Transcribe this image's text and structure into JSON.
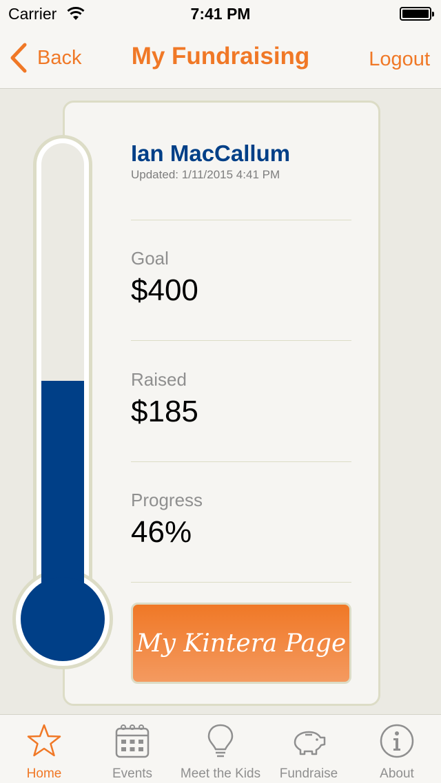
{
  "status_bar": {
    "carrier": "Carrier",
    "time": "7:41 PM"
  },
  "navbar": {
    "back_label": "Back",
    "title": "My Fundraising",
    "logout_label": "Logout"
  },
  "profile": {
    "name": "Ian MacCallum",
    "updated": "Updated: 1/11/2015 4:41 PM"
  },
  "stats": {
    "goal_label": "Goal",
    "goal_value": "$400",
    "raised_label": "Raised",
    "raised_value": "$185",
    "progress_label": "Progress",
    "progress_value": "46%"
  },
  "thermometer": {
    "progress_fraction": 0.46
  },
  "kintera_button": "My Kintera Page",
  "tabs": [
    {
      "label": "Home",
      "icon": "star-icon",
      "active": true
    },
    {
      "label": "Events",
      "icon": "calendar-icon",
      "active": false
    },
    {
      "label": "Meet the Kids",
      "icon": "lightbulb-icon",
      "active": false
    },
    {
      "label": "Fundraise",
      "icon": "piggy-bank-icon",
      "active": false
    },
    {
      "label": "About",
      "icon": "info-icon",
      "active": false
    }
  ],
  "colors": {
    "accent": "#f07826",
    "brand_blue": "#003f87",
    "muted": "#8f8f8f",
    "border": "#dcdcc6"
  }
}
